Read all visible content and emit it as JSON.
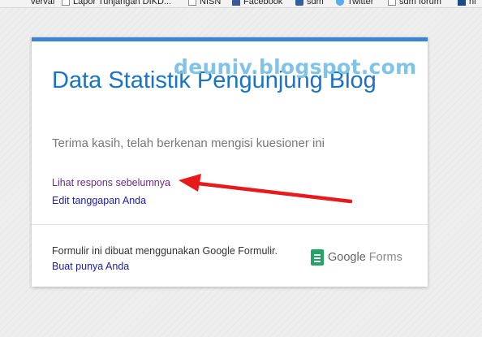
{
  "bookmarks": [
    {
      "label": "vervai",
      "icon": "none"
    },
    {
      "label": "Lapor Tunjangan DIKD...",
      "icon": "page-icon"
    },
    {
      "label": "NISN",
      "icon": "page-icon"
    },
    {
      "label": "Facebook",
      "icon": "facebook-icon"
    },
    {
      "label": "sdm",
      "icon": "sdm-icon"
    },
    {
      "label": "Twitter",
      "icon": "twitter-icon"
    },
    {
      "label": "sdm forum",
      "icon": "page-icon"
    },
    {
      "label": "ni",
      "icon": "bookmark-icon"
    }
  ],
  "form": {
    "title": "Data Statistik Pengunjung Blog",
    "confirmation": "Terima kasih, telah berkenan mengisi kuesioner ini",
    "view_responses_link": "Lihat respons sebelumnya",
    "edit_response_link": "Edit tanggapan Anda",
    "footer_note": "Formulir ini dibuat menggunakan Google Formulir.",
    "create_link": "Buat punya Anda",
    "brand": {
      "google": "Google",
      "forms": "Forms"
    },
    "accent_color": "#3a83d5"
  },
  "watermark": "deuniv.blogspot.com",
  "annotation": {
    "arrow_color": "#e8191a"
  }
}
